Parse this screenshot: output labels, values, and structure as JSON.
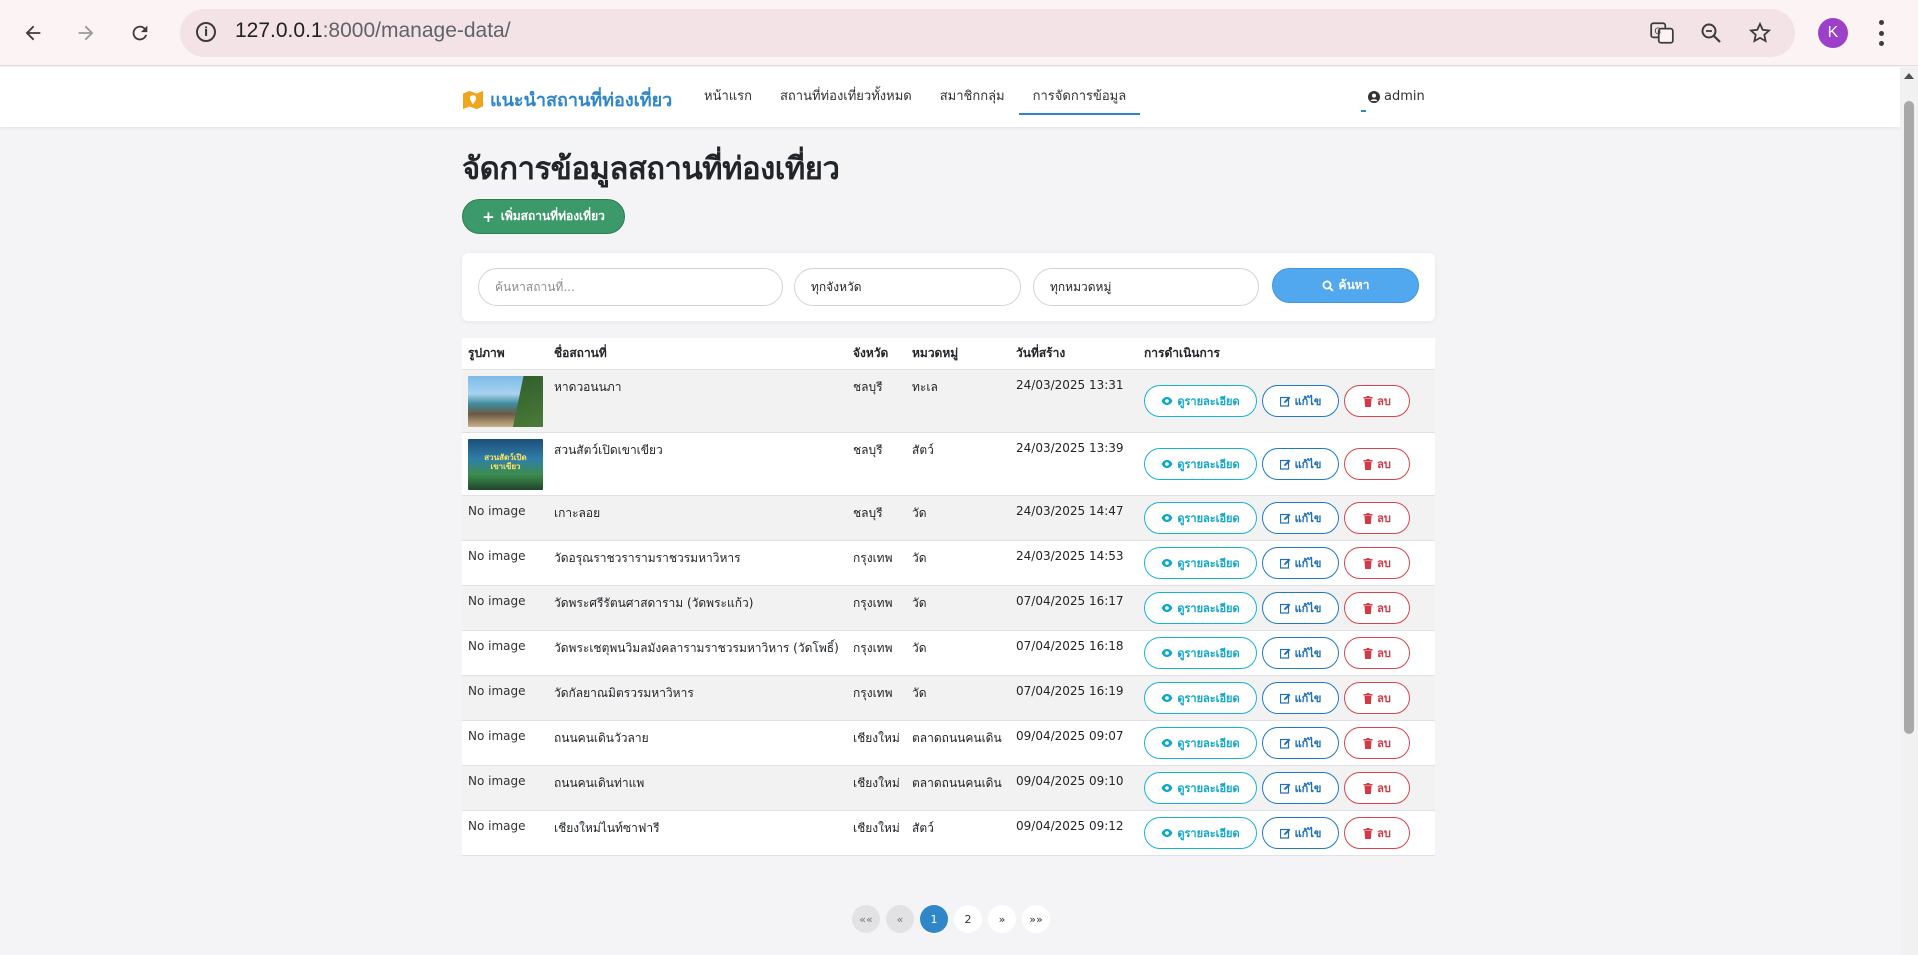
{
  "browser": {
    "url_host": "127.0.0.1",
    "url_path": ":8000/manage-data/",
    "profile_initial": "K"
  },
  "navbar": {
    "brand": "แนะนำสถานที่ท่องเที่ยว",
    "links": [
      {
        "label": "หน้าแรก",
        "active": false
      },
      {
        "label": "สถานที่ท่องเที่ยวทั้งหมด",
        "active": false
      },
      {
        "label": "สมาชิกกลุ่ม",
        "active": false
      },
      {
        "label": "การจัดการข้อมูล",
        "active": true
      }
    ],
    "user": "admin"
  },
  "page": {
    "title": "จัดการข้อมูลสถานที่ท่องเที่ยว",
    "add_button": "เพิ่มสถานที่ท่องเที่ยว"
  },
  "search": {
    "placeholder": "ค้นหาสถานที่...",
    "province_value": "ทุกจังหวัด",
    "category_value": "ทุกหมวดหมู่",
    "button": "ค้นหา"
  },
  "table": {
    "headers": [
      "รูปภาพ",
      "ชื่อสถานที่",
      "จังหวัด",
      "หมวดหมู่",
      "วันที่สร้าง",
      "การดำเนินการ"
    ],
    "view_label": "ดูรายละเอียด",
    "edit_label": "แก้ไข",
    "delete_label": "ลบ",
    "rows": [
      {
        "image": "beach",
        "name": "หาดวอนนภา",
        "province": "ชลบุรี",
        "category": "ทะเล",
        "created": "24/03/2025 13:31"
      },
      {
        "image": "zoo",
        "image_text": "สวนสัตว์เปิด เขาเขียว",
        "name": "สวนสัตว์เปิดเขาเขียว",
        "province": "ชลบุรี",
        "category": "สัตว์",
        "created": "24/03/2025 13:39"
      },
      {
        "image": "none",
        "image_alt": "No image",
        "name": "เกาะลอย",
        "province": "ชลบุรี",
        "category": "วัด",
        "created": "24/03/2025 14:47"
      },
      {
        "image": "none",
        "image_alt": "No image",
        "name": "วัดอรุณราชวรารามราชวรมหาวิหาร",
        "province": "กรุงเทพ",
        "category": "วัด",
        "created": "24/03/2025 14:53"
      },
      {
        "image": "none",
        "image_alt": "No image",
        "name": "วัดพระศรีรัตนศาสดาราม (วัดพระแก้ว)",
        "province": "กรุงเทพ",
        "category": "วัด",
        "created": "07/04/2025 16:17"
      },
      {
        "image": "none",
        "image_alt": "No image",
        "name": "วัดพระเชตุพนวิมลมังคลารามราชวรมหาวิหาร (วัดโพธิ์)",
        "province": "กรุงเทพ",
        "category": "วัด",
        "created": "07/04/2025 16:18"
      },
      {
        "image": "none",
        "image_alt": "No image",
        "name": "วัดกัลยาณมิตรวรมหาวิหาร",
        "province": "กรุงเทพ",
        "category": "วัด",
        "created": "07/04/2025 16:19"
      },
      {
        "image": "none",
        "image_alt": "No image",
        "name": "ถนนคนเดินวัวลาย",
        "province": "เชียงใหม่",
        "category": "ตลาดถนนคนเดิน",
        "created": "09/04/2025 09:07"
      },
      {
        "image": "none",
        "image_alt": "No image",
        "name": "ถนนคนเดินท่าแพ",
        "province": "เชียงใหม่",
        "category": "ตลาดถนนคนเดิน",
        "created": "09/04/2025 09:10"
      },
      {
        "image": "none",
        "image_alt": "No image",
        "name": "เชียงใหม่ไนท์ซาฟารี",
        "province": "เชียงใหม่",
        "category": "สัตว์",
        "created": "09/04/2025 09:12"
      }
    ]
  },
  "pagination": {
    "first": "««",
    "prev": "«",
    "pages": [
      "1",
      "2"
    ],
    "current": "1",
    "next": "»",
    "last": "»»"
  }
}
